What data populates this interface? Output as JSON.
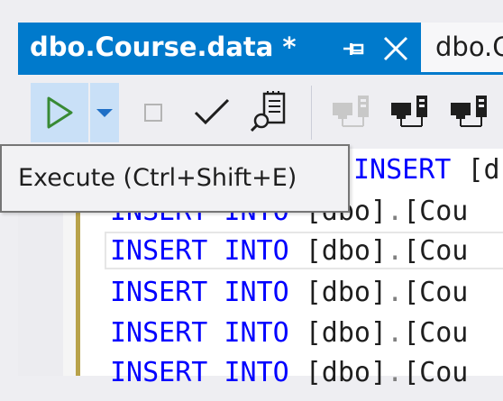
{
  "tabs": {
    "active": {
      "title": "dbo.Course.data *"
    },
    "inactive": {
      "title": "dbo.C"
    }
  },
  "toolbar": {
    "execute": {
      "icon": "play-icon",
      "color": "#388a34"
    },
    "dropdown": {
      "icon": "chevron-down-icon",
      "color": "#1e6fc6"
    },
    "stop": {
      "icon": "stop-icon",
      "enabled": false
    },
    "parse": {
      "icon": "checkmark-icon"
    },
    "estimated_plan": {
      "icon": "execution-plan-icon"
    },
    "connections": [
      {
        "icon": "connect-icon",
        "enabled": false
      },
      {
        "icon": "disconnect-icon",
        "enabled": true
      },
      {
        "icon": "change-connection-icon",
        "enabled": true
      }
    ]
  },
  "tooltip": {
    "text": "Execute (Ctrl+Shift+E)"
  },
  "editor": {
    "colors": {
      "keyword": "#0000ff",
      "plain": "#1e1e1e",
      "operator": "#808080",
      "change_bar": "#b8a24a"
    },
    "lines": [
      {
        "k1": "INSERT",
        "k2": "",
        "obj": "[d",
        "dot": "",
        "rest": ""
      },
      {
        "k1": "INSERT",
        "k2": "INTO",
        "obj": "[dbo]",
        "dot": ".",
        "rest": "[Cou"
      },
      {
        "k1": "INSERT",
        "k2": "INTO",
        "obj": "[dbo]",
        "dot": ".",
        "rest": "[Cou"
      },
      {
        "k1": "INSERT",
        "k2": "INTO",
        "obj": "[dbo]",
        "dot": ".",
        "rest": "[Cou"
      },
      {
        "k1": "INSERT",
        "k2": "INTO",
        "obj": "[dbo]",
        "dot": ".",
        "rest": "[Cou"
      },
      {
        "k1": "INSERT",
        "k2": "INTO",
        "obj": "[dbo]",
        "dot": ".",
        "rest": "[Cou"
      }
    ]
  }
}
